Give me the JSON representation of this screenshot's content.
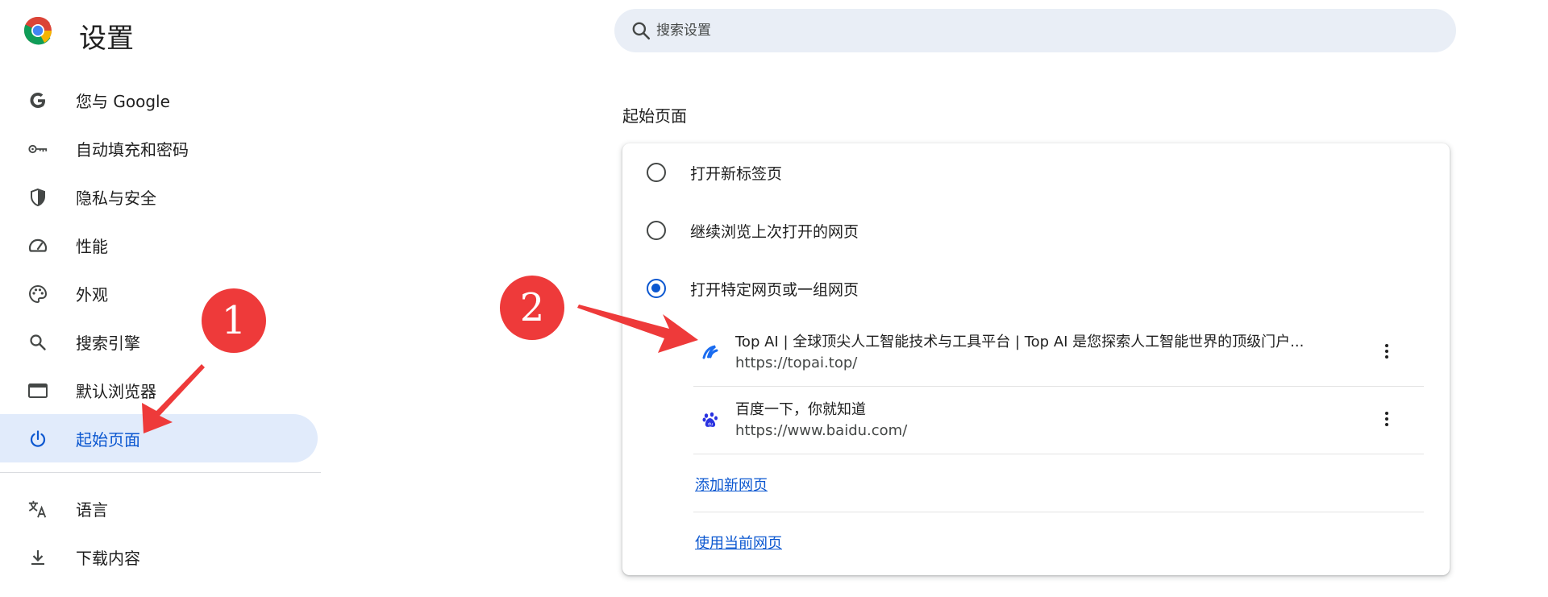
{
  "header": {
    "title": "设置",
    "search_placeholder": "搜索设置"
  },
  "sidebar": {
    "items": [
      {
        "label": "您与 Google",
        "icon": "google-g-icon"
      },
      {
        "label": "自动填充和密码",
        "icon": "key-icon"
      },
      {
        "label": "隐私与安全",
        "icon": "shield-icon"
      },
      {
        "label": "性能",
        "icon": "speedometer-icon"
      },
      {
        "label": "外观",
        "icon": "palette-icon"
      },
      {
        "label": "搜索引擎",
        "icon": "search-icon"
      },
      {
        "label": "默认浏览器",
        "icon": "browser-window-icon"
      },
      {
        "label": "起始页面",
        "icon": "power-icon",
        "active": true
      },
      {
        "label": "语言",
        "icon": "translate-icon"
      },
      {
        "label": "下载内容",
        "icon": "download-icon"
      }
    ]
  },
  "main": {
    "section_title": "起始页面",
    "options": [
      {
        "label": "打开新标签页",
        "checked": false
      },
      {
        "label": "继续浏览上次打开的网页",
        "checked": false
      },
      {
        "label": "打开特定网页或一组网页",
        "checked": true
      }
    ],
    "pages": [
      {
        "title": "Top AI | 全球顶尖人工智能技术与工具平台 | Top AI 是您探索人工智能世界的顶级门户...",
        "url": "https://topai.top/",
        "favicon": "topai-logo-icon"
      },
      {
        "title": "百度一下，你就知道",
        "url": "https://www.baidu.com/",
        "favicon": "baidu-paw-icon"
      }
    ],
    "add_page_link": "添加新网页",
    "use_current_link": "使用当前网页"
  },
  "annotations": {
    "badge_1": "1",
    "badge_2": "2",
    "color": "#ee3a3a"
  },
  "colors": {
    "accent": "#0b57d0",
    "active_nav_bg": "#e1ebfb",
    "search_bg": "#e9eef6"
  }
}
